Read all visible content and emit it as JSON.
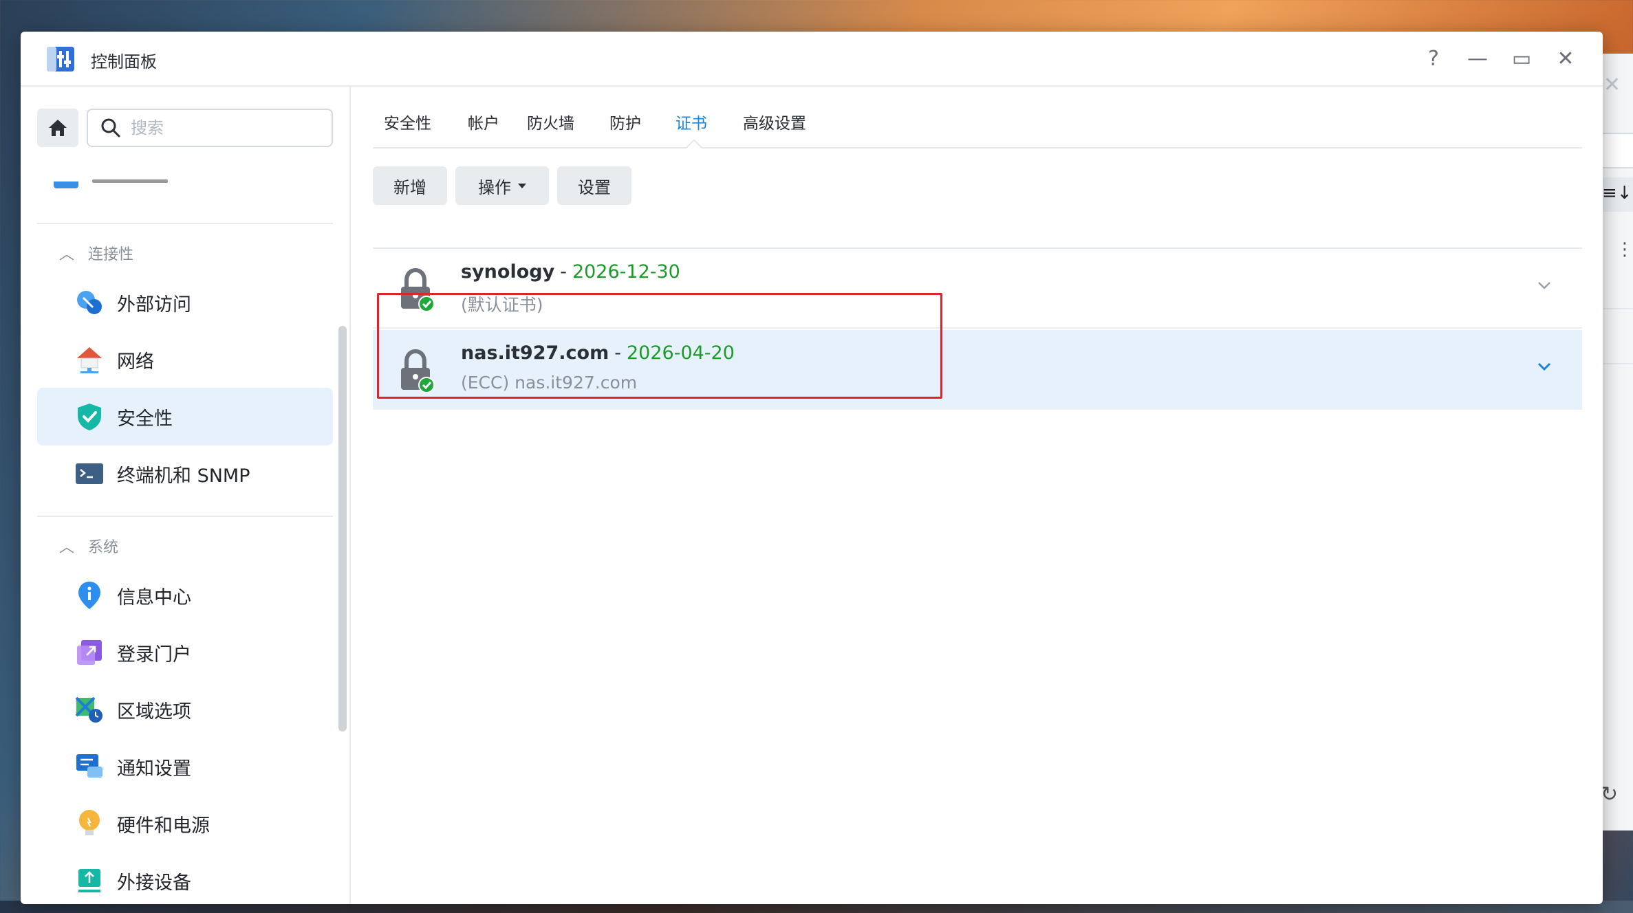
{
  "window": {
    "title": "控制面板",
    "help": "?",
    "minimize": "—",
    "maximize": "▭",
    "close": "✕"
  },
  "sidebar": {
    "search_placeholder": "搜索",
    "sections": [
      {
        "title": "连接性",
        "items": [
          "外部访问",
          "网络",
          "安全性",
          "终端机和 SNMP"
        ]
      },
      {
        "title": "系统",
        "items": [
          "信息中心",
          "登录门户",
          "区域选项",
          "通知设置",
          "硬件和电源",
          "外接设备"
        ]
      }
    ],
    "active_item": "安全性"
  },
  "tabs": [
    "安全性",
    "帐户",
    "防火墙",
    "防护",
    "证书",
    "高级设置"
  ],
  "active_tab": "证书",
  "toolbar": {
    "add": "新增",
    "action": "操作",
    "settings": "设置"
  },
  "certificates": [
    {
      "name": "synology",
      "expiry": "2026-12-30",
      "subtitle": "(默认证书)",
      "selected": false
    },
    {
      "name": "nas.it927.com",
      "expiry": "2026-04-20",
      "subtitle": "(ECC) nas.it927.com",
      "selected": true
    }
  ],
  "colors": {
    "accent": "#1c84e0",
    "expiry_green": "#1e9a2a",
    "selection": "#e6f1fc",
    "highlight_red": "#e0242b"
  }
}
